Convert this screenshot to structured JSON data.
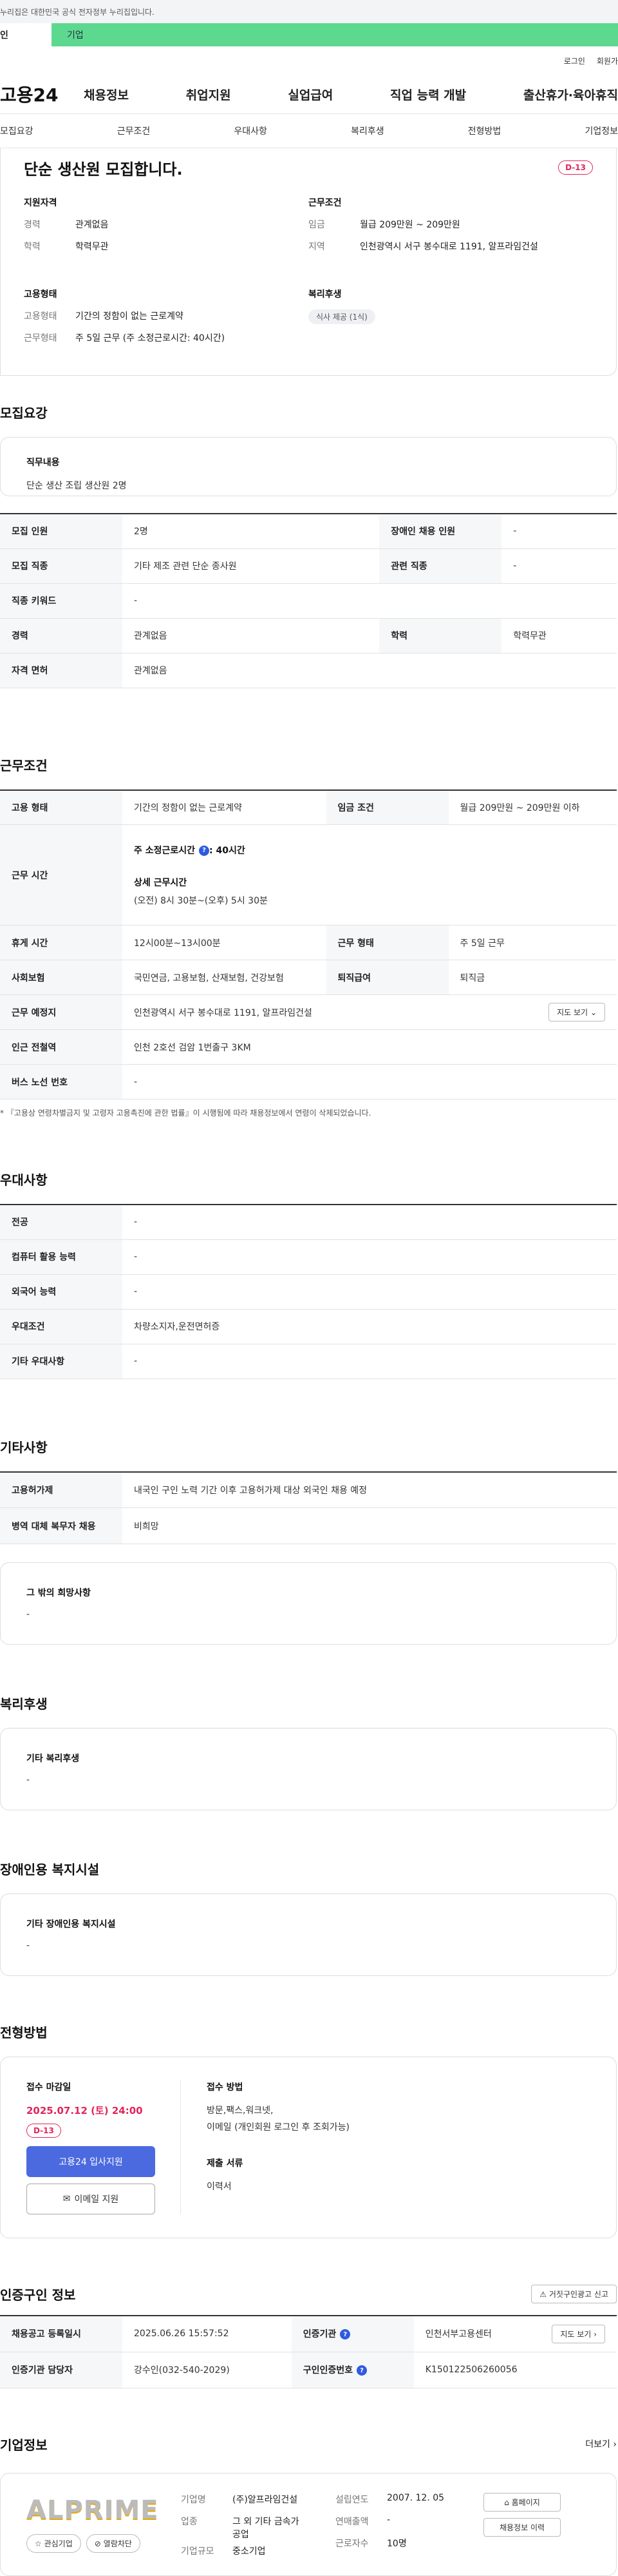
{
  "gov_notice": "누리집은 대한민국 공식 전자정부 누리집입니다.",
  "tabs": {
    "person": "인",
    "company": "기업"
  },
  "util": {
    "login": "로그인",
    "signup": "회원가"
  },
  "gnb": {
    "logo": "고용24",
    "items": [
      "채용정보",
      "취업지원",
      "실업급여",
      "직업 능력 개발",
      "출산휴가·육아휴직"
    ]
  },
  "subnav": [
    "모집요강",
    "근무조건",
    "우대사항",
    "복리후생",
    "전형방법",
    "기업정보"
  ],
  "summary": {
    "title": "단순 생산원 모집합니다.",
    "dday": "D-13",
    "qual_h": "지원자격",
    "career_k": "경력",
    "career_v": "관계없음",
    "edu_k": "학력",
    "edu_v": "학력무관",
    "emp_h": "고용형태",
    "emp_k1": "고용형태",
    "emp_v1": "기간의 정함이 없는 근로계약",
    "emp_k2": "근무형태",
    "emp_v2": "주 5일 근무 (주 소정근로시간: 40시간)",
    "cond_h": "근무조건",
    "wage_k": "임금",
    "wage_v": "월급 209만원 ~ 209만원",
    "region_k": "지역",
    "region_v": "인천광역시 서구 봉수대로 1191, 알프라임건설",
    "welfare_h": "복리후생",
    "welfare_chip": "식사 제공 (1식)"
  },
  "recruit": {
    "title": "모집요강",
    "duty_h": "직무내용",
    "duty_v": "단순 생산 조립 생산원 2명",
    "rows": {
      "count_k": "모집 인원",
      "count_v": "2명",
      "disabled_k": "장애인 채용 인원",
      "disabled_v": "-",
      "job_k": "모집 직종",
      "job_v": "기타 제조 관련 단순 종사원",
      "related_k": "관련 직종",
      "related_v": "-",
      "kw_k": "직종 키워드",
      "kw_v": "-",
      "career_k": "경력",
      "career_v": "관계없음",
      "edu_k": "학력",
      "edu_v": "학력무관",
      "license_k": "자격 면허",
      "license_v": "관계없음"
    }
  },
  "work": {
    "title": "근무조건",
    "emp_k": "고용 형태",
    "emp_v": "기간의 정함이 없는 근로계약",
    "wage_k": "임금 조건",
    "wage_v": "월급 209만원 ~ 209만원 이하",
    "hours_k": "근무 시간",
    "hours_main": "주 소정근로시간",
    "hours_main_v": ": 40시간",
    "hours_detail_h": "상세 근무시간",
    "hours_detail_v": "(오전) 8시 30분~(오후) 5시 30분",
    "break_k": "휴게 시간",
    "break_v": "12시00분~13시00분",
    "type_k": "근무 형태",
    "type_v": "주 5일 근무",
    "ins_k": "사회보험",
    "ins_v": "국민연금, 고용보험, 산재보험, 건강보험",
    "retire_k": "퇴직급여",
    "retire_v": "퇴직금",
    "place_k": "근무 예정지",
    "place_v": "인천광역시 서구 봉수대로 1191, 알프라임건설",
    "map_btn": "지도 보기",
    "subway_k": "인근 전철역",
    "subway_v": "인천 2호선 검암 1번출구 3KM",
    "bus_k": "버스 노선 번호",
    "bus_v": "-",
    "note": "* 『고용상 연령차별금지 및 고령자 고용촉진에 관한 법률』이 시행됨에 따라 채용정보에서 연령이 삭제되었습니다."
  },
  "pref": {
    "title": "우대사항",
    "major_k": "전공",
    "major_v": "-",
    "pc_k": "컴퓨터 활용 능력",
    "pc_v": "-",
    "lang_k": "외국어 능력",
    "lang_v": "-",
    "cond_k": "우대조건",
    "cond_v": "차량소지자,운전면허증",
    "etc_k": "기타 우대사항",
    "etc_v": "-"
  },
  "etc": {
    "title": "기타사항",
    "foreign_k": "고용허가제",
    "foreign_v": "내국인 구인 노력 기간 이후 고용허가제 대상 외국인 채용 예정",
    "military_k": "병역 대체 복무자 채용",
    "military_v": "비희망",
    "wish_h": "그 밖의 희망사항",
    "wish_v": "-"
  },
  "welfare": {
    "title": "복리후생",
    "h": "기타 복리후생",
    "v": "-"
  },
  "facility": {
    "title": "장애인용 복지시설",
    "h": "기타 장애인용 복지시설",
    "v": "-"
  },
  "process": {
    "title": "전형방법",
    "deadline_h": "접수 마감일",
    "deadline_v": "2025.07.12 (토) 24:00",
    "dday": "D-13",
    "apply_btn": "고용24 입사지원",
    "email_btn": "이메일 지원",
    "method_h": "접수 방법",
    "method_v1": "방문,팩스,워크넷,",
    "method_v2": "이메일 (개인회원 로그인 후 조회가능)",
    "docs_h": "제출 서류",
    "docs_v": "이력서"
  },
  "cert": {
    "title": "인증구인 정보",
    "report_btn": "거짓구인광고 신고",
    "reg_k": "채용공고 등록일시",
    "reg_v": "2025.06.26 15:57:52",
    "org_k": "인증기관",
    "org_v": "인천서부고용센터",
    "map_btn": "지도 보기",
    "mgr_k": "인증기관 담당자",
    "mgr_v": "강수인(032-540-2029)",
    "no_k": "구인인증번호",
    "no_v": "K150122506260056"
  },
  "company": {
    "title": "기업정보",
    "more": "더보기",
    "logo_text": "ALPRIME",
    "fav_btn": "관심기업",
    "block_btn": "열람차단",
    "name_k": "기업명",
    "name_v": "(주)알프라임건설",
    "industry_k": "업종",
    "industry_v1": "그 외 기타 금속가",
    "industry_v2": "공업",
    "size_k": "기업규모",
    "size_v": "중소기업",
    "founded_k": "설립연도",
    "founded_v": "2007. 12. 05",
    "sales_k": "연매출액",
    "sales_v": "-",
    "emp_k": "근로자수",
    "emp_v": "10명",
    "home_btn": "홈페이지",
    "jobs_btn": "채용정보 이력"
  }
}
